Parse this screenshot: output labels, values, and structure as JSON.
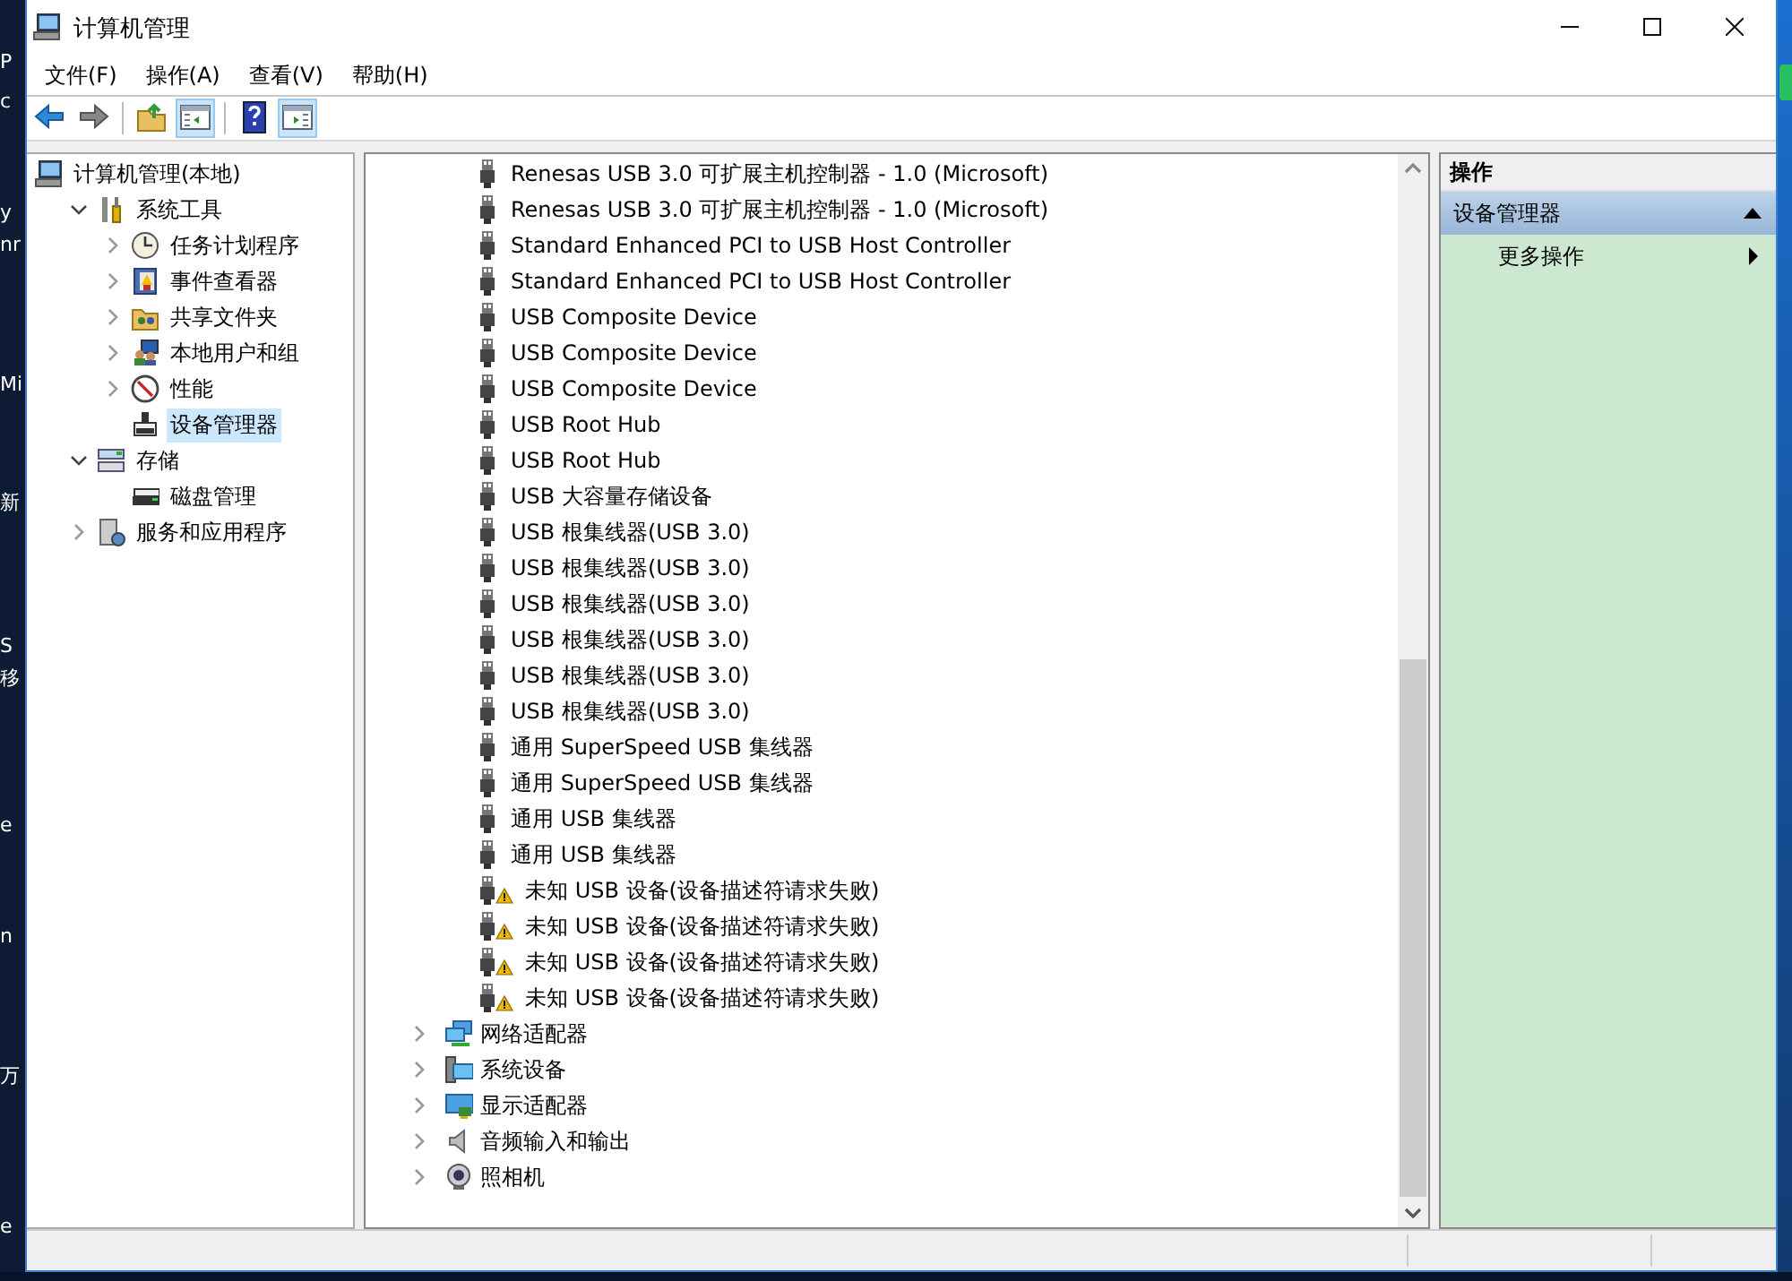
{
  "desktop": {
    "left_labels": [
      "P",
      "c",
      "y",
      "nr",
      "Mi",
      "新",
      "S",
      "移",
      "e",
      "n",
      "万",
      "e"
    ]
  },
  "window": {
    "title": "计算机管理"
  },
  "menu": [
    "文件(F)",
    "操作(A)",
    "查看(V)",
    "帮助(H)"
  ],
  "toolbar": [
    {
      "kind": "back"
    },
    {
      "kind": "forward"
    },
    {
      "kind": "sep"
    },
    {
      "kind": "up"
    },
    {
      "kind": "tree-toggle",
      "on": true
    },
    {
      "kind": "sep"
    },
    {
      "kind": "help"
    },
    {
      "kind": "action-toggle",
      "on": true
    }
  ],
  "tree": [
    {
      "label": "计算机管理(本地)",
      "kind": "computer",
      "selected": false,
      "children": [
        {
          "label": "系统工具",
          "kind": "tools",
          "expanded": true,
          "selected": false,
          "children": [
            {
              "label": "任务计划程序",
              "kind": "clock",
              "expanded": false,
              "selected": false
            },
            {
              "label": "事件查看器",
              "kind": "event",
              "expanded": false,
              "selected": false
            },
            {
              "label": "共享文件夹",
              "kind": "share",
              "expanded": false,
              "selected": false
            },
            {
              "label": "本地用户和组",
              "kind": "users",
              "expanded": false,
              "selected": false
            },
            {
              "label": "性能",
              "kind": "perf",
              "expanded": false,
              "selected": false
            },
            {
              "label": "设备管理器",
              "kind": "device",
              "selected": true
            }
          ]
        },
        {
          "label": "存储",
          "kind": "storage",
          "expanded": true,
          "selected": false,
          "children": [
            {
              "label": "磁盘管理",
              "kind": "disk",
              "selected": false
            }
          ]
        },
        {
          "label": "服务和应用程序",
          "kind": "services",
          "expanded": false,
          "selected": false
        }
      ]
    }
  ],
  "devices": [
    {
      "kind": "usb",
      "label": "Renesas USB 3.0 可扩展主机控制器 - 1.0 (Microsoft)",
      "warning": false
    },
    {
      "kind": "usb",
      "label": "Renesas USB 3.0 可扩展主机控制器 - 1.0 (Microsoft)",
      "warning": false
    },
    {
      "kind": "usb",
      "label": "Standard Enhanced PCI to USB Host Controller",
      "warning": false
    },
    {
      "kind": "usb",
      "label": "Standard Enhanced PCI to USB Host Controller",
      "warning": false
    },
    {
      "kind": "usb",
      "label": "USB Composite Device",
      "warning": false
    },
    {
      "kind": "usb",
      "label": "USB Composite Device",
      "warning": false
    },
    {
      "kind": "usb",
      "label": "USB Composite Device",
      "warning": false
    },
    {
      "kind": "usb",
      "label": "USB Root Hub",
      "warning": false
    },
    {
      "kind": "usb",
      "label": "USB Root Hub",
      "warning": false
    },
    {
      "kind": "usb",
      "label": "USB 大容量存储设备",
      "warning": false
    },
    {
      "kind": "usb",
      "label": "USB 根集线器(USB 3.0)",
      "warning": false
    },
    {
      "kind": "usb",
      "label": "USB 根集线器(USB 3.0)",
      "warning": false
    },
    {
      "kind": "usb",
      "label": "USB 根集线器(USB 3.0)",
      "warning": false
    },
    {
      "kind": "usb",
      "label": "USB 根集线器(USB 3.0)",
      "warning": false
    },
    {
      "kind": "usb",
      "label": "USB 根集线器(USB 3.0)",
      "warning": false
    },
    {
      "kind": "usb",
      "label": "USB 根集线器(USB 3.0)",
      "warning": false
    },
    {
      "kind": "usb",
      "label": "通用 SuperSpeed USB 集线器",
      "warning": false
    },
    {
      "kind": "usb",
      "label": "通用 SuperSpeed USB 集线器",
      "warning": false
    },
    {
      "kind": "usb",
      "label": "通用 USB 集线器",
      "warning": false
    },
    {
      "kind": "usb",
      "label": "通用 USB 集线器",
      "warning": false
    },
    {
      "kind": "usb",
      "label": "未知 USB 设备(设备描述符请求失败)",
      "warning": true
    },
    {
      "kind": "usb",
      "label": "未知 USB 设备(设备描述符请求失败)",
      "warning": true
    },
    {
      "kind": "usb",
      "label": "未知 USB 设备(设备描述符请求失败)",
      "warning": true
    },
    {
      "kind": "usb",
      "label": "未知 USB 设备(设备描述符请求失败)",
      "warning": true
    },
    {
      "kind": "network",
      "label": "网络适配器",
      "expanded": false
    },
    {
      "kind": "system",
      "label": "系统设备",
      "expanded": false
    },
    {
      "kind": "display",
      "label": "显示适配器",
      "expanded": false
    },
    {
      "kind": "audio",
      "label": "音频输入和输出",
      "expanded": false
    },
    {
      "kind": "camera",
      "label": "照相机",
      "expanded": false
    }
  ],
  "actions": {
    "header": "操作",
    "sections": [
      {
        "title": "设备管理器",
        "expanded": true,
        "items": [
          {
            "label": "更多操作",
            "submenu": true
          }
        ]
      }
    ]
  }
}
